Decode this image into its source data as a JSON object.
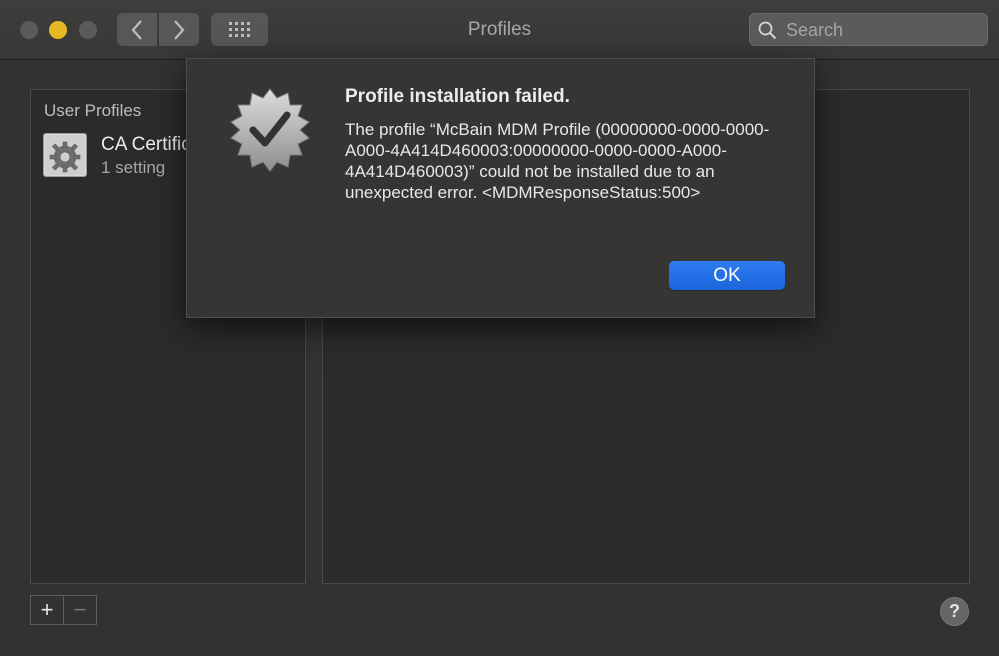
{
  "window": {
    "title": "Profiles"
  },
  "search": {
    "placeholder": "Search"
  },
  "sidebar": {
    "section_label": "User Profiles",
    "items": [
      {
        "name": "CA Certific",
        "subtitle": "1 setting",
        "icon": "gear-icon"
      }
    ]
  },
  "footer": {
    "add_label": "+",
    "remove_label": "−",
    "help_label": "?"
  },
  "dialog": {
    "title": "Profile installation failed.",
    "message": "The profile “McBain MDM Profile (00000000-0000-0000-A000-4A414D460003:00000000-0000-0000-A000-4A414D460003)” could not be installed due to an unexpected error. <MDMResponseStatus:500>",
    "ok_label": "OK",
    "icon": "verified-badge-icon"
  },
  "colors": {
    "accent": "#1c66dc",
    "minimize": "#e5b824"
  }
}
